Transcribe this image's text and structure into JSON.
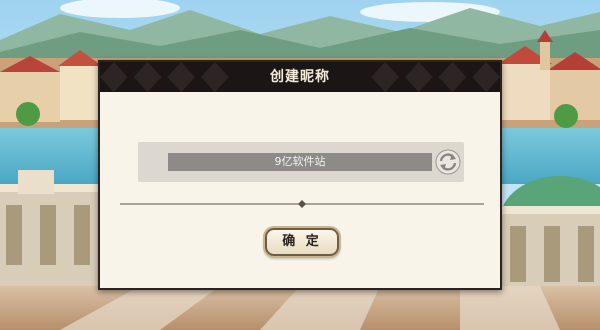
{
  "dialog": {
    "title": "创建昵称",
    "nickname_value": "9亿软件站",
    "refresh_icon": "refresh-icon",
    "confirm_label": "确 定"
  },
  "colors": {
    "header_bg": "#1b1615",
    "dialog_bg": "#f8f4ea",
    "field_bg": "#8d8a87",
    "panel_bg": "#dcd7cf"
  }
}
